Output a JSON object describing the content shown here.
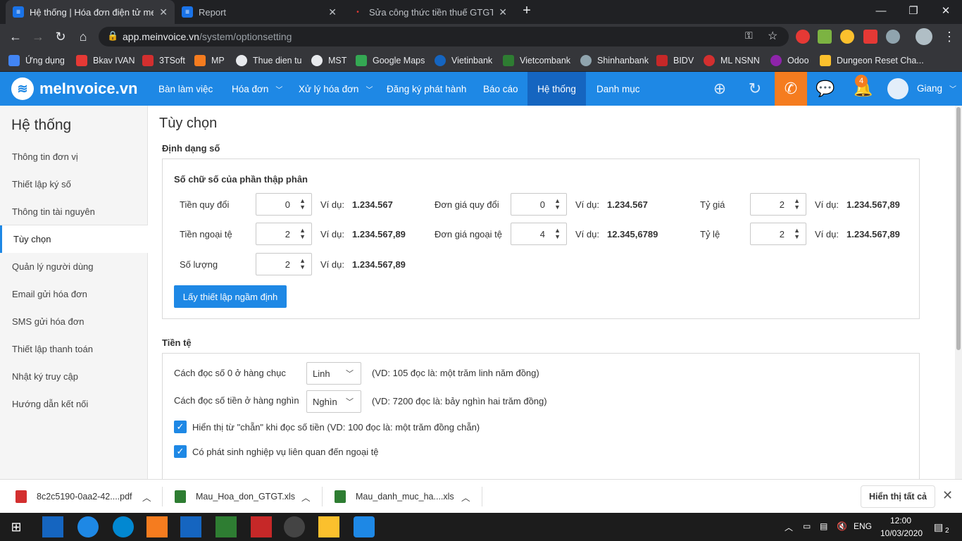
{
  "browser": {
    "tabs": [
      {
        "title": "Hệ thống | Hóa đơn điện tử meInvoice",
        "active": true
      },
      {
        "title": "Report",
        "active": false
      },
      {
        "title": "Sửa công thức tiền thuế GTGT. | N",
        "active": false
      }
    ],
    "new_tab": "+",
    "url_host": "app.meinvoice.vn",
    "url_path": "/system/optionsetting",
    "bookmarks": [
      "Ứng dụng",
      "Bkav IVAN",
      "3TSoft",
      "MP",
      "Thue dien tu",
      "MST",
      "Google Maps",
      "Vietinbank",
      "Vietcombank",
      "Shinhanbank",
      "BIDV",
      "ML NSNN",
      "Odoo",
      "Dungeon Reset Cha..."
    ]
  },
  "app": {
    "logo": "meInvoice.vn",
    "menu": [
      "Bàn làm việc",
      "Hóa đơn",
      "Xử lý hóa đơn",
      "Đăng ký phát hành",
      "Báo cáo",
      "Hệ thống",
      "Danh mục"
    ],
    "active_menu": "Hệ thống",
    "notification_count": "4",
    "user": "Giang"
  },
  "sidebar": {
    "title": "Hệ thống",
    "items": [
      "Thông tin đơn vị",
      "Thiết lập ký số",
      "Thông tin tài nguyên",
      "Tùy chọn",
      "Quản lý người dùng",
      "Email gửi hóa đơn",
      "SMS gửi hóa đơn",
      "Thiết lập thanh toán",
      "Nhật ký truy cập",
      "Hướng dẫn kết nối"
    ],
    "active": "Tùy chọn"
  },
  "main": {
    "title": "Tùy chọn",
    "number_format": {
      "section": "Định dạng số",
      "subtitle": "Số chữ số của phần thập phân",
      "example_label": "Ví dụ:",
      "fields": [
        {
          "label": "Tiền quy đổi",
          "value": "0",
          "example": "1.234.567"
        },
        {
          "label": "Đơn giá quy đổi",
          "value": "0",
          "example": "1.234.567"
        },
        {
          "label": "Tỷ giá",
          "value": "2",
          "example": "1.234.567,89"
        },
        {
          "label": "Tiền ngoại tệ",
          "value": "2",
          "example": "1.234.567,89"
        },
        {
          "label": "Đơn giá ngoại tệ",
          "value": "4",
          "example": "12.345,6789"
        },
        {
          "label": "Tỷ lệ",
          "value": "2",
          "example": "1.234.567,89"
        },
        {
          "label": "Số lượng",
          "value": "2",
          "example": "1.234.567,89"
        }
      ],
      "default_button": "Lấy thiết lập ngầm định"
    },
    "currency": {
      "section": "Tiền tệ",
      "zero_label": "Cách đọc số 0 ở hàng chục",
      "zero_value": "Linh",
      "zero_hint": "(VD: 105 đọc là: một trăm linh năm đồng)",
      "thousand_label": "Cách đọc số tiền ở hàng nghìn",
      "thousand_value": "Nghìn",
      "thousand_hint": "(VD: 7200 đọc là: bảy nghìn hai trăm đồng)",
      "check1": "Hiển thị từ \"chẵn\" khi đọc số tiền (VD: 100 đọc là: một trăm đồng chẵn)",
      "check2": "Có phát sinh nghiệp vụ liên quan đến ngoại tệ"
    }
  },
  "downloads": {
    "items": [
      "8c2c5190-0aa2-42....pdf",
      "Mau_Hoa_don_GTGT.xls",
      "Mau_danh_muc_ha....xls"
    ],
    "show_all": "Hiển thị tất cả"
  },
  "taskbar": {
    "lang": "ENG",
    "time": "12:00",
    "date": "10/03/2020",
    "notif": "2"
  },
  "colors": {
    "primary": "#1e88e5",
    "active_menu": "#1565c0",
    "phone": "#f57c1f"
  }
}
